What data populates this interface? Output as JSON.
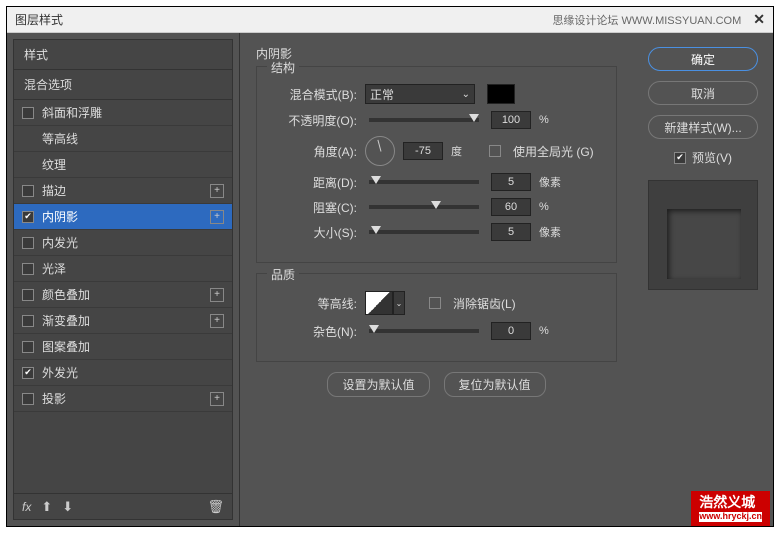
{
  "title": "图层样式",
  "titlebar_right": "思缘设计论坛  WWW.MISSYUAN.COM",
  "sidebar": {
    "header1": "样式",
    "header2": "混合选项",
    "items": [
      {
        "label": "斜面和浮雕",
        "checked": false,
        "plus": false,
        "indent": false
      },
      {
        "label": "等高线",
        "checked": false,
        "plus": false,
        "indent": true
      },
      {
        "label": "纹理",
        "checked": false,
        "plus": false,
        "indent": true
      },
      {
        "label": "描边",
        "checked": false,
        "plus": true,
        "indent": false
      },
      {
        "label": "内阴影",
        "checked": true,
        "plus": true,
        "indent": false,
        "selected": true
      },
      {
        "label": "内发光",
        "checked": false,
        "plus": false,
        "indent": false
      },
      {
        "label": "光泽",
        "checked": false,
        "plus": false,
        "indent": false
      },
      {
        "label": "颜色叠加",
        "checked": false,
        "plus": true,
        "indent": false
      },
      {
        "label": "渐变叠加",
        "checked": false,
        "plus": true,
        "indent": false
      },
      {
        "label": "图案叠加",
        "checked": false,
        "plus": false,
        "indent": false
      },
      {
        "label": "外发光",
        "checked": true,
        "plus": false,
        "indent": false
      },
      {
        "label": "投影",
        "checked": false,
        "plus": true,
        "indent": false
      }
    ],
    "fx": "fx"
  },
  "panel": {
    "title": "内阴影",
    "structure": {
      "title": "结构",
      "blend_mode_label": "混合模式(B):",
      "blend_mode_value": "正常",
      "opacity_label": "不透明度(O):",
      "opacity_value": "100",
      "opacity_unit": "%",
      "angle_label": "角度(A):",
      "angle_value": "-75",
      "angle_unit": "度",
      "global_light_label": "使用全局光 (G)",
      "distance_label": "距离(D):",
      "distance_value": "5",
      "distance_unit": "像素",
      "spread_label": "阻塞(C):",
      "spread_value": "60",
      "spread_unit": "%",
      "size_label": "大小(S):",
      "size_value": "5",
      "size_unit": "像素"
    },
    "quality": {
      "title": "品质",
      "contour_label": "等高线:",
      "antialias_label": "消除锯齿(L)",
      "noise_label": "杂色(N):",
      "noise_value": "0",
      "noise_unit": "%"
    },
    "set_default": "设置为默认值",
    "reset_default": "复位为默认值"
  },
  "buttons": {
    "ok": "确定",
    "cancel": "取消",
    "new_style": "新建样式(W)...",
    "preview": "预览(V)"
  },
  "watermark": {
    "name": "浩然义城",
    "url": "www.hryckj.cn"
  }
}
